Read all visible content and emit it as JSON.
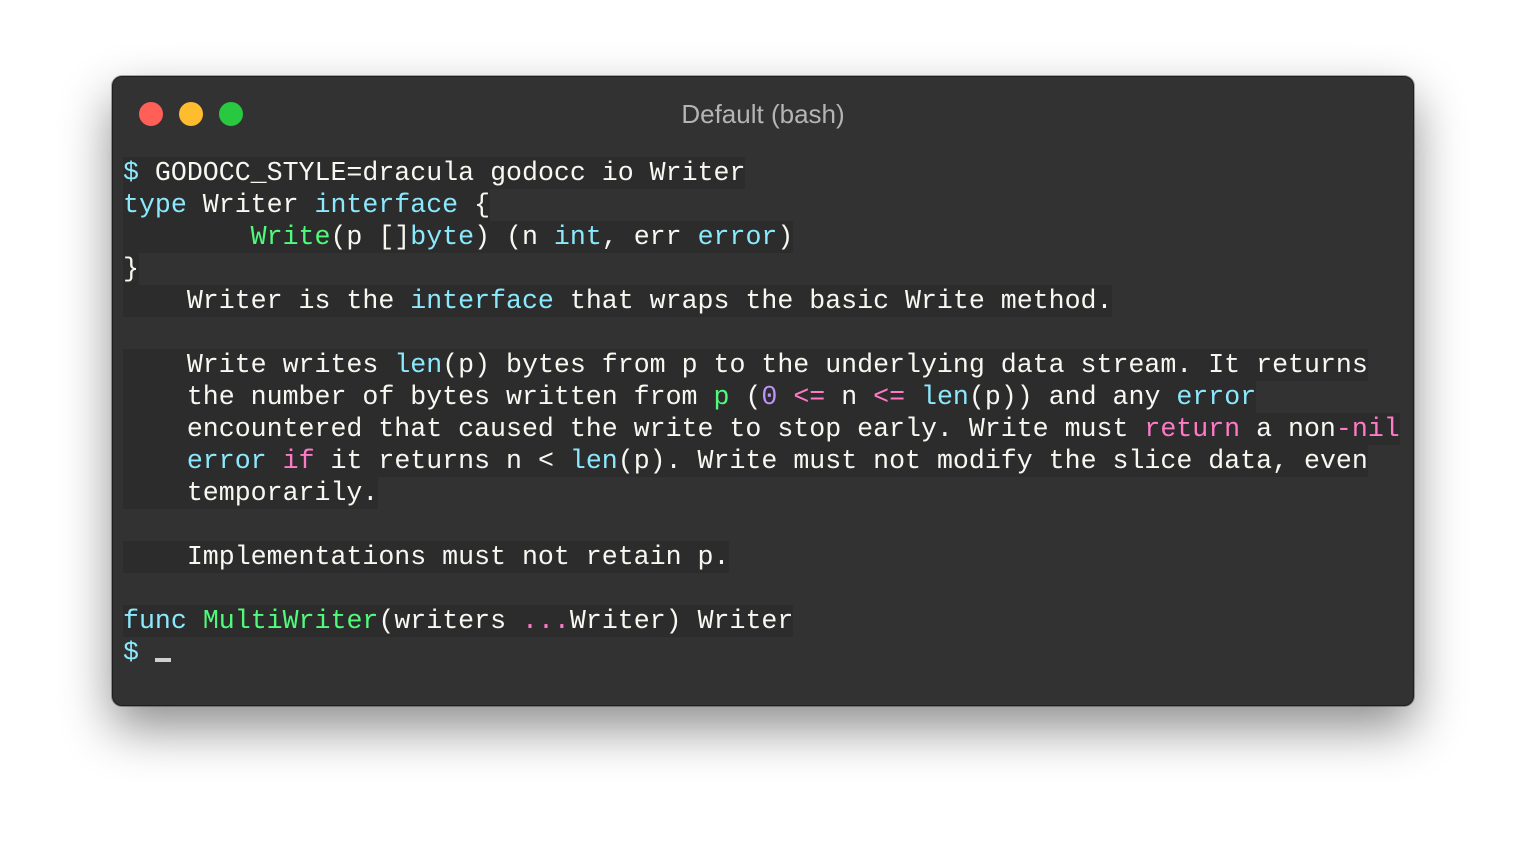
{
  "window": {
    "title": "Default (bash)",
    "traffic_lights": {
      "close": "#fe5f57",
      "minimize": "#febc2e",
      "zoom": "#28c840"
    }
  },
  "colors": {
    "fg": "#f8f8f2",
    "cyan": "#8be9fd",
    "green": "#50fa7b",
    "pink": "#ff79c6",
    "purple": "#bd93f9"
  },
  "terminal": {
    "lines": [
      [
        {
          "t": "$",
          "c": "cyan"
        },
        {
          "t": " GODOCC_STYLE=dracula godocc io Writer",
          "c": "fg"
        }
      ],
      [
        {
          "t": "type",
          "c": "cyan"
        },
        {
          "t": " Writer ",
          "c": "fg"
        },
        {
          "t": "interface",
          "c": "cyan"
        },
        {
          "t": " {",
          "c": "fg"
        }
      ],
      [
        {
          "t": "        ",
          "c": "fg"
        },
        {
          "t": "Write",
          "c": "green"
        },
        {
          "t": "(p []",
          "c": "fg"
        },
        {
          "t": "byte",
          "c": "cyan"
        },
        {
          "t": ") (n ",
          "c": "fg"
        },
        {
          "t": "int",
          "c": "cyan"
        },
        {
          "t": ", err ",
          "c": "fg"
        },
        {
          "t": "error",
          "c": "cyan"
        },
        {
          "t": ")",
          "c": "fg"
        }
      ],
      [
        {
          "t": "}",
          "c": "fg"
        }
      ],
      [
        {
          "t": "    Writer is the ",
          "c": "fg"
        },
        {
          "t": "interface",
          "c": "cyan"
        },
        {
          "t": " that wraps the basic Write method.",
          "c": "fg"
        }
      ],
      [],
      [
        {
          "t": "    Write writes ",
          "c": "fg"
        },
        {
          "t": "len",
          "c": "cyan"
        },
        {
          "t": "(p) bytes from p to the underlying data stream. It returns",
          "c": "fg"
        }
      ],
      [
        {
          "t": "    the number of bytes written from ",
          "c": "fg"
        },
        {
          "t": "p",
          "c": "green"
        },
        {
          "t": " (",
          "c": "fg"
        },
        {
          "t": "0",
          "c": "purple"
        },
        {
          "t": " ",
          "c": "fg"
        },
        {
          "t": "<=",
          "c": "pink"
        },
        {
          "t": " n ",
          "c": "fg"
        },
        {
          "t": "<=",
          "c": "pink"
        },
        {
          "t": " ",
          "c": "fg"
        },
        {
          "t": "len",
          "c": "cyan"
        },
        {
          "t": "(p)) and any ",
          "c": "fg"
        },
        {
          "t": "error",
          "c": "cyan"
        }
      ],
      [
        {
          "t": "    encountered that caused the write to stop early. Write must ",
          "c": "fg"
        },
        {
          "t": "return",
          "c": "pink"
        },
        {
          "t": " a non",
          "c": "fg"
        },
        {
          "t": "-nil",
          "c": "pink"
        }
      ],
      [
        {
          "t": "    ",
          "c": "fg"
        },
        {
          "t": "error",
          "c": "cyan"
        },
        {
          "t": " ",
          "c": "fg"
        },
        {
          "t": "if",
          "c": "pink"
        },
        {
          "t": " it returns n < ",
          "c": "fg"
        },
        {
          "t": "len",
          "c": "cyan"
        },
        {
          "t": "(p). Write must not modify the slice data, even",
          "c": "fg"
        }
      ],
      [
        {
          "t": "    temporarily.",
          "c": "fg"
        }
      ],
      [],
      [
        {
          "t": "    Implementations must not retain p.",
          "c": "fg"
        }
      ],
      [],
      [
        {
          "t": "func",
          "c": "cyan"
        },
        {
          "t": " ",
          "c": "fg"
        },
        {
          "t": "MultiWriter",
          "c": "green"
        },
        {
          "t": "(writers ",
          "c": "fg"
        },
        {
          "t": "...",
          "c": "pink"
        },
        {
          "t": "Writer) Writer",
          "c": "fg"
        }
      ]
    ],
    "prompt": "$ "
  }
}
